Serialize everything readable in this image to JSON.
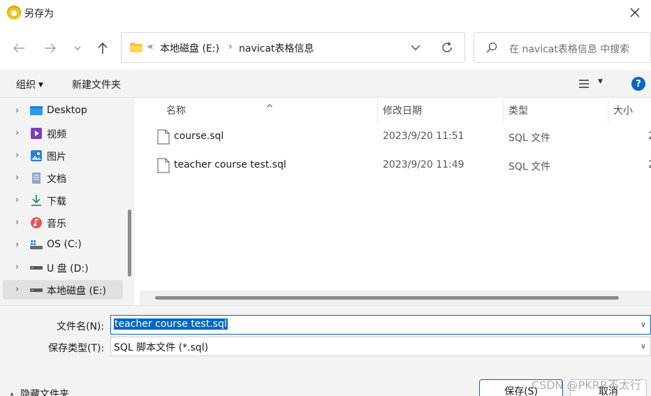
{
  "window": {
    "title": "另存为",
    "close_icon": "close-icon"
  },
  "address": {
    "prefix": "«",
    "crumbs": [
      "本地磁盘 (E:)",
      "navicat表格信息"
    ],
    "separator": "›"
  },
  "search": {
    "placeholder": "在 navicat表格信息 中搜索"
  },
  "toolbar": {
    "organize": "组织",
    "new_folder": "新建文件夹",
    "help": "?"
  },
  "sidebar": {
    "items": [
      {
        "label": "Desktop",
        "icon": "desktop-icon"
      },
      {
        "label": "视频",
        "icon": "videos-icon"
      },
      {
        "label": "图片",
        "icon": "pictures-icon"
      },
      {
        "label": "文档",
        "icon": "documents-icon"
      },
      {
        "label": "下载",
        "icon": "downloads-icon"
      },
      {
        "label": "音乐",
        "icon": "music-icon"
      },
      {
        "label": "OS (C:)",
        "icon": "drive-c-icon"
      },
      {
        "label": "U 盘 (D:)",
        "icon": "usb-drive-icon"
      },
      {
        "label": "本地磁盘 (E:)",
        "icon": "drive-e-icon",
        "selected": true
      }
    ]
  },
  "files": {
    "columns": {
      "name": "名称",
      "modified": "修改日期",
      "type": "类型",
      "size": "大小"
    },
    "rows": [
      {
        "name": "course.sql",
        "modified": "2023/9/20 11:51",
        "type": "SQL 文件",
        "size": "2"
      },
      {
        "name": "teacher course test.sql",
        "modified": "2023/9/20 11:49",
        "type": "SQL 文件",
        "size": "2"
      }
    ]
  },
  "form": {
    "filename_label": "文件名(N):",
    "filename_value": "teacher course test.sql",
    "filetype_label": "保存类型(T):",
    "filetype_value": "SQL 脚本文件 (*.sql)",
    "hide_folders": "隐藏文件夹",
    "save": "保存(S)",
    "cancel": "取消"
  },
  "watermark": "CSDN @PKRR不太行",
  "colors": {
    "accent": "#0067c0",
    "selected_nav": "#e0e0e0",
    "pane_bg": "#f3f3f3"
  }
}
